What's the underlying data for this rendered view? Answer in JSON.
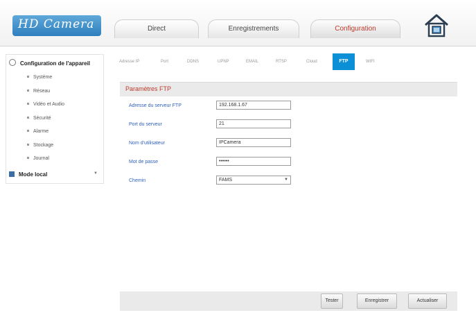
{
  "header": {
    "logo_text": "HD Camera",
    "tabs": [
      {
        "label": "Direct"
      },
      {
        "label": "Enregistrements"
      },
      {
        "label": "Configuration",
        "active": true
      }
    ],
    "accent_color": "#c0392b",
    "home_icon": "home-icon"
  },
  "sidebar": {
    "title": "Configuration de l'appareil",
    "items": [
      {
        "label": "Système"
      },
      {
        "label": "Réseau"
      },
      {
        "label": "Vidéo et Audio"
      },
      {
        "label": "Sécurité"
      },
      {
        "label": "Alarme"
      },
      {
        "label": "Stockage"
      },
      {
        "label": "Journal"
      }
    ],
    "local_mode": "Mode local"
  },
  "subtabs": [
    {
      "label": "Adresse IP"
    },
    {
      "label": "Port"
    },
    {
      "label": "DDNS"
    },
    {
      "label": "UPNP"
    },
    {
      "label": "EMAIL"
    },
    {
      "label": "RTSP"
    },
    {
      "label": "Cloud"
    },
    {
      "label": "FTP",
      "active": true
    },
    {
      "label": "WIFI"
    }
  ],
  "ftp": {
    "section_title": "Paramètres FTP",
    "fields": [
      {
        "label": "Adresse du serveur FTP",
        "value": "192.168.1.67"
      },
      {
        "label": "Port du serveur",
        "value": "21"
      },
      {
        "label": "Nom d'utilisateur",
        "value": "IPCamera"
      },
      {
        "label": "Mot de passe",
        "value": "••••••"
      }
    ],
    "channel": {
      "label": "Chemin",
      "value": "FAMS"
    }
  },
  "buttons": {
    "test": "Tester",
    "save": "Enregistrer",
    "refresh": "Actualiser"
  },
  "colors": {
    "active_tab_blue": "#0b8fd6",
    "label_blue": "#2e5fbf",
    "title_red": "#c0392b"
  }
}
